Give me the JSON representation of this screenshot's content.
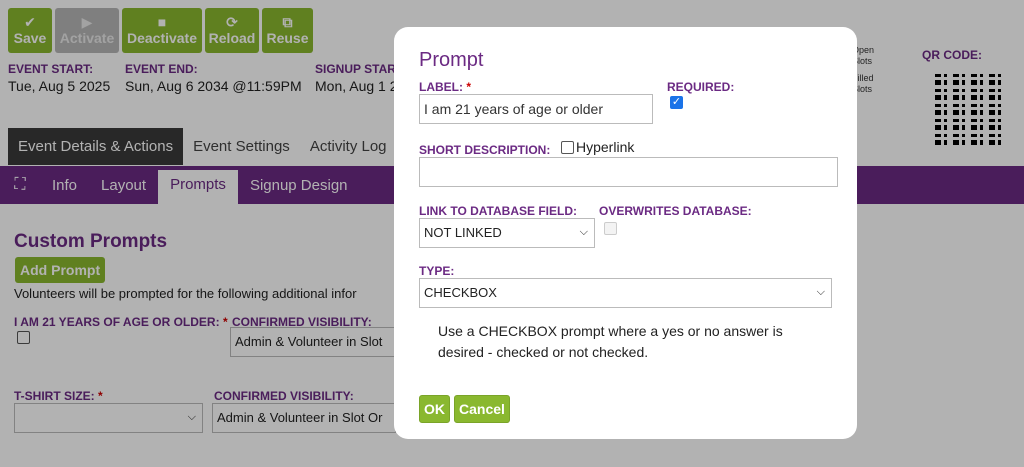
{
  "toolbar": {
    "buttons": [
      {
        "label": "Save",
        "icon": "✔"
      },
      {
        "label": "Activate",
        "icon": "▶"
      },
      {
        "label": "Deactivate",
        "icon": "■"
      },
      {
        "label": "Reload",
        "icon": "⟳"
      },
      {
        "label": "Reuse",
        "icon": "⧉"
      }
    ]
  },
  "event": {
    "start_label": "EVENT START:",
    "start_value": "Tue, Aug 5 2025",
    "end_label": "EVENT END:",
    "end_value": "Sun, Aug 6 2034 @11:59PM",
    "signup_label": "SIGNUP STAR",
    "signup_value": "Mon, Aug 1 2"
  },
  "slots": {
    "line1": "Open",
    "line2": "Slots",
    "line3": "Filled",
    "line4": "Slots"
  },
  "qr_label": "QR CODE:",
  "tabs_top": [
    "Event Details & Actions",
    "Event Settings",
    "Activity Log"
  ],
  "tabs_sub": [
    "Info",
    "Layout",
    "Prompts",
    "Signup Design"
  ],
  "prompts_page": {
    "title": "Custom Prompts",
    "add_button": "Add Prompt",
    "intro": "Volunteers will be prompted for the following additional infor",
    "prompt1_label": "I AM 21 YEARS OF AGE OR OLDER:",
    "prompt1_vis_label": "CONFIRMED VISIBILITY:",
    "prompt1_vis_value": "Admin & Volunteer in Slot",
    "prompt2_label": "T-SHIRT SIZE:",
    "prompt2_vis_label": "CONFIRMED VISIBILITY:",
    "prompt2_vis_value": "Admin & Volunteer in Slot Or"
  },
  "modal": {
    "title": "Prompt",
    "label_field_label": "LABEL:",
    "label_value": "I am 21 years of age or older",
    "required_label": "REQUIRED:",
    "required_checked": true,
    "short_desc_label": "SHORT DESCRIPTION:",
    "hyperlink_label": "Hyperlink",
    "short_desc_value": "",
    "link_db_label": "LINK TO DATABASE FIELD:",
    "link_db_value": "NOT LINKED",
    "overwrites_label": "OVERWRITES DATABASE:",
    "type_label": "TYPE:",
    "type_value": "CHECKBOX",
    "help_text": "Use a CHECKBOX prompt where a yes or no answer is desired - checked or not checked.",
    "ok_label": "OK",
    "cancel_label": "Cancel"
  },
  "colors": {
    "accent": "#6b2a83",
    "button": "#8ab82f"
  }
}
